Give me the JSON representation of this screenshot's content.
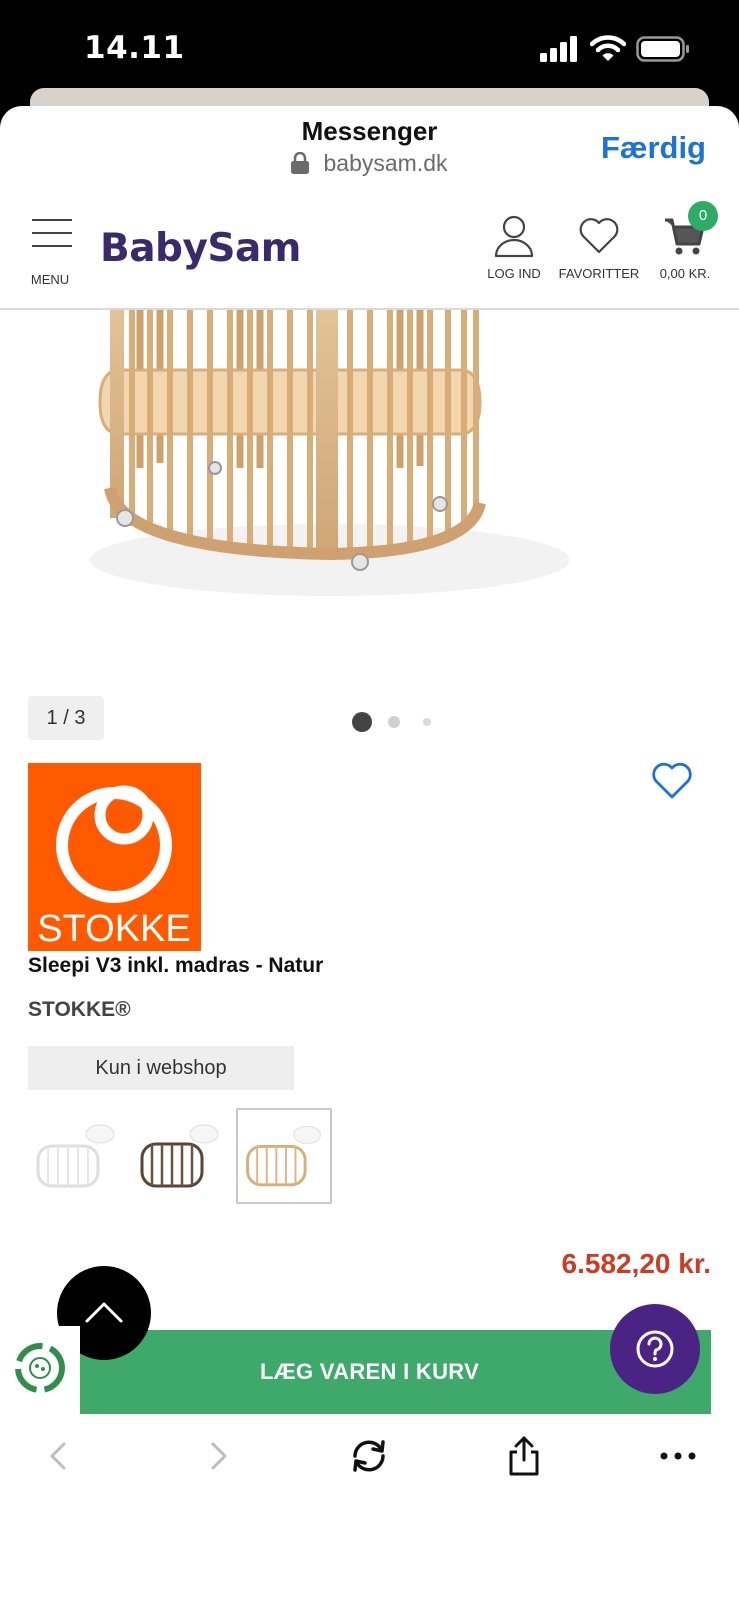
{
  "status_bar": {
    "time": "14.11"
  },
  "browser": {
    "title": "Messenger",
    "url": "babysam.dk",
    "done_label": "Færdig"
  },
  "site_header": {
    "menu_label": "MENU",
    "logo_text": "BabySam",
    "login_label": "LOG IND",
    "favorites_label": "FAVORITTER",
    "cart_total": "0,00 KR.",
    "cart_count": "0"
  },
  "product": {
    "image_counter": "1 / 3",
    "gallery_dots": 3,
    "gallery_active_index": 0,
    "brand_logo_text": "STOKKE",
    "name": "Sleepi V3 inkl. madras - Natur",
    "brand": "STOKKE®",
    "availability_tag": "Kun i webshop",
    "variants": [
      "white",
      "walnut",
      "natural"
    ],
    "selected_variant": "natural",
    "price": "6.582,20 kr.",
    "add_to_cart_label": "LÆG VAREN I KURV"
  },
  "colors": {
    "brand_purple": "#3b2a6b",
    "link_blue": "#1a73d9",
    "cta_green": "#3ea96a",
    "price_red": "#cc3b22",
    "stokke_orange": "#ff5a00",
    "help_purple": "#4b2384"
  },
  "icons": {
    "status": [
      "signal-icon",
      "wifi-icon",
      "battery-icon"
    ],
    "header": [
      "menu-icon",
      "user-icon",
      "heart-icon",
      "cart-icon"
    ],
    "floating": [
      "chevron-up-icon",
      "question-icon",
      "eco-badge-icon"
    ],
    "toolbar": [
      "back-icon",
      "forward-icon",
      "reload-icon",
      "share-icon",
      "more-icon"
    ]
  }
}
